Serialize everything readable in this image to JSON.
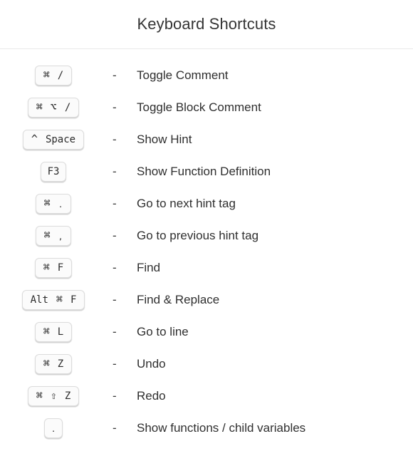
{
  "header": {
    "title": "Keyboard Shortcuts",
    "divider_color": "#e9e9e9",
    "title_color": "#343434"
  },
  "separator": "-",
  "badge_style": {
    "background": "#fbfbfb",
    "border_color": "#dcdcdc",
    "text_color": "#2b2b2b"
  },
  "shortcuts": [
    {
      "keys": [
        "⌘",
        "/"
      ],
      "key_text": "⌘ /",
      "separator": "-",
      "description": "Toggle Comment"
    },
    {
      "keys": [
        "⌘",
        "⌥",
        "/"
      ],
      "key_text": "⌘ ⌥ /",
      "separator": "-",
      "description": "Toggle Block Comment"
    },
    {
      "keys": [
        "^",
        "Space"
      ],
      "key_text": "^ Space",
      "separator": "-",
      "description": "Show Hint"
    },
    {
      "keys": [
        "F3"
      ],
      "key_text": "F3",
      "separator": "-",
      "description": "Show Function Definition"
    },
    {
      "keys": [
        "⌘",
        "."
      ],
      "key_text": "⌘ .",
      "separator": "-",
      "description": "Go to next hint tag"
    },
    {
      "keys": [
        "⌘",
        ","
      ],
      "key_text": "⌘ ,",
      "separator": "-",
      "description": "Go to previous hint tag"
    },
    {
      "keys": [
        "⌘",
        "F"
      ],
      "key_text": "⌘ F",
      "separator": "-",
      "description": "Find"
    },
    {
      "keys": [
        "Alt",
        "⌘",
        "F"
      ],
      "key_text": "Alt ⌘ F",
      "separator": "-",
      "description": "Find & Replace"
    },
    {
      "keys": [
        "⌘",
        "L"
      ],
      "key_text": "⌘ L",
      "separator": "-",
      "description": "Go to line"
    },
    {
      "keys": [
        "⌘",
        "Z"
      ],
      "key_text": "⌘ Z",
      "separator": "-",
      "description": "Undo"
    },
    {
      "keys": [
        "⌘",
        "⇧",
        "Z"
      ],
      "key_text": "⌘ ⇧ Z",
      "separator": "-",
      "description": "Redo"
    },
    {
      "keys": [
        "."
      ],
      "key_text": ".",
      "separator": "-",
      "description": "Show functions / child variables"
    }
  ]
}
